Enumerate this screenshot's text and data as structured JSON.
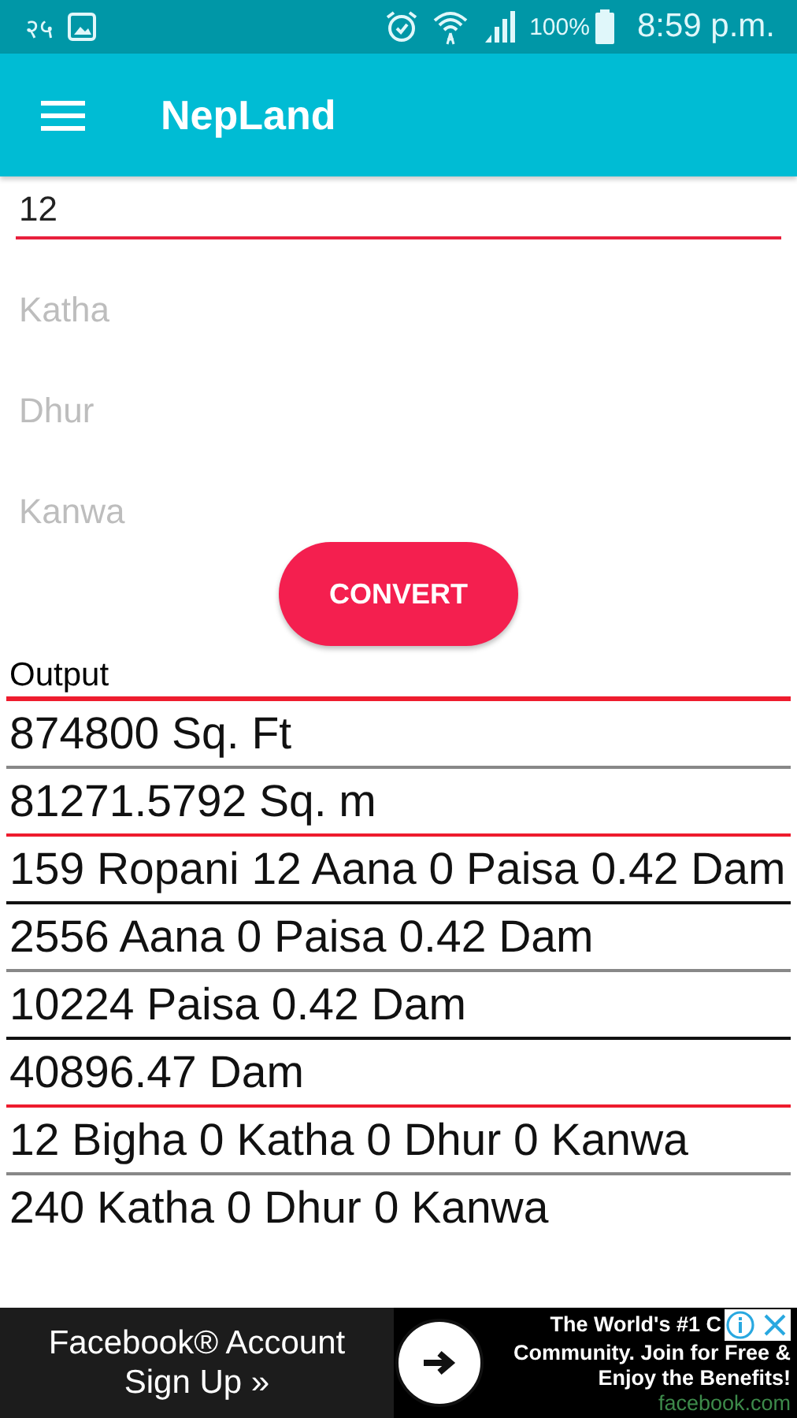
{
  "status_bar": {
    "left_text": "२५",
    "battery": "100%",
    "time": "8:59 p.m."
  },
  "app_bar": {
    "title": "NepLand"
  },
  "fields": [
    {
      "value": "12",
      "focused": true
    },
    {
      "placeholder": "Katha",
      "focused": false
    },
    {
      "placeholder": "Dhur",
      "focused": false
    },
    {
      "placeholder": "Kanwa",
      "focused": false
    }
  ],
  "convert_button": "CONVERT",
  "output": {
    "label": "Output",
    "color": "#ee1c2e",
    "rows": [
      {
        "text": "874800 Sq. Ft",
        "color": "#888888"
      },
      {
        "text": "81271.5792 Sq. m",
        "color": "#ee1c2e"
      },
      {
        "text": "159 Ropani 12 Aana 0 Paisa 0.42 Dam",
        "color": "#111111"
      },
      {
        "text": "2556 Aana 0 Paisa 0.42 Dam",
        "color": "#888888"
      },
      {
        "text": "10224 Paisa 0.42 Dam",
        "color": "#111111"
      },
      {
        "text": "40896.47 Dam",
        "color": "#ee1c2e"
      },
      {
        "text": "12 Bigha 0 Katha 0 Dhur 0 Kanwa",
        "color": "#888888"
      },
      {
        "text": "240 Katha 0 Dhur 0 Kanwa"
      }
    ]
  },
  "ad": {
    "headline": "Facebook® Account Sign Up »",
    "lines": [
      "The World's #1 C",
      "Community. Join for Free &",
      "Enjoy the Benefits!"
    ],
    "domain": "facebook.com"
  }
}
